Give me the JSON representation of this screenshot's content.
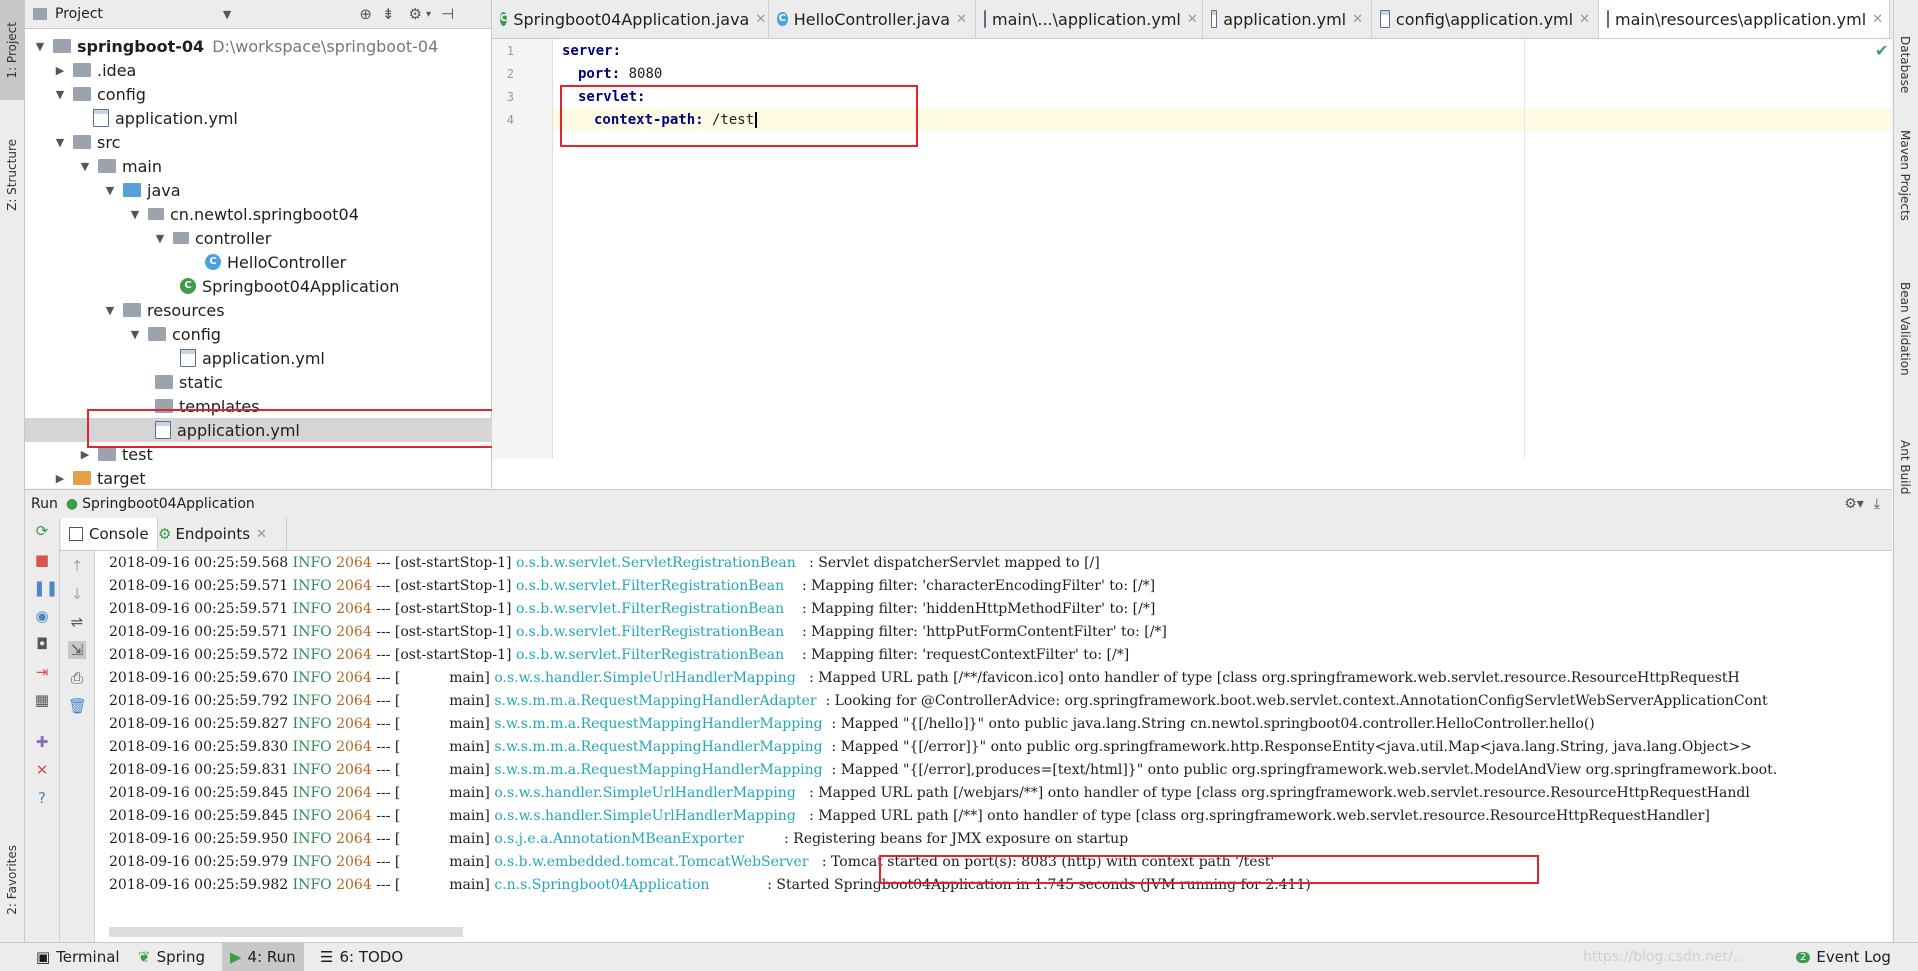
{
  "left_stripe": {
    "project": "1: Project",
    "structure": "Z: Structure",
    "favorites": "2: Favorites"
  },
  "right_stripe": {
    "database": "Database",
    "maven": "Maven Projects",
    "bean": "Bean Validation",
    "ant": "Ant Build"
  },
  "project_panel": {
    "title": "Project",
    "root_name": "springboot-04",
    "root_path": "D:\\workspace\\springboot-04",
    "items": [
      {
        "label": "springboot-04"
      },
      {
        "label": ".idea"
      },
      {
        "label": "config"
      },
      {
        "label": "application.yml"
      },
      {
        "label": "src"
      },
      {
        "label": "main"
      },
      {
        "label": "java"
      },
      {
        "label": "cn.newtol.springboot04"
      },
      {
        "label": "controller"
      },
      {
        "label": "HelloController"
      },
      {
        "label": "Springboot04Application"
      },
      {
        "label": "resources"
      },
      {
        "label": "config"
      },
      {
        "label": "application.yml"
      },
      {
        "label": "static"
      },
      {
        "label": "templates"
      },
      {
        "label": "application.yml"
      },
      {
        "label": "test"
      },
      {
        "label": "target"
      }
    ]
  },
  "editor_tabs": [
    {
      "label": "Springboot04Application.java"
    },
    {
      "label": "HelloController.java"
    },
    {
      "label": "main\\...\\application.yml"
    },
    {
      "label": "application.yml"
    },
    {
      "label": "config\\application.yml"
    },
    {
      "label": "main\\resources\\application.yml"
    }
  ],
  "editor": {
    "line_numbers": [
      "1",
      "2",
      "3",
      "4"
    ],
    "lines": [
      {
        "key": "server:",
        "val": ""
      },
      {
        "key": "port:",
        "val": " 8080"
      },
      {
        "key": "servlet:",
        "val": ""
      },
      {
        "key": "context-path:",
        "val": " /test"
      }
    ]
  },
  "run": {
    "label": "Run",
    "config": "Springboot04Application",
    "tabs": [
      {
        "label": "Console"
      },
      {
        "label": "Endpoints"
      }
    ]
  },
  "console": {
    "lines": [
      {
        "ts": "2018-09-16 00:25:59.568",
        "level": "INFO",
        "pid": "2064",
        "sep": "---",
        "thread": "[ost-startStop-1]",
        "logger": "o.s.b.w.servlet.ServletRegistrationBean  ",
        "msg": " : Servlet dispatcherServlet mapped to [/]"
      },
      {
        "ts": "2018-09-16 00:25:59.571",
        "level": "INFO",
        "pid": "2064",
        "sep": "---",
        "thread": "[ost-startStop-1]",
        "logger": "o.s.b.w.servlet.FilterRegistrationBean   ",
        "msg": " : Mapping filter: 'characterEncodingFilter' to: [/*]"
      },
      {
        "ts": "2018-09-16 00:25:59.571",
        "level": "INFO",
        "pid": "2064",
        "sep": "---",
        "thread": "[ost-startStop-1]",
        "logger": "o.s.b.w.servlet.FilterRegistrationBean   ",
        "msg": " : Mapping filter: 'hiddenHttpMethodFilter' to: [/*]"
      },
      {
        "ts": "2018-09-16 00:25:59.571",
        "level": "INFO",
        "pid": "2064",
        "sep": "---",
        "thread": "[ost-startStop-1]",
        "logger": "o.s.b.w.servlet.FilterRegistrationBean   ",
        "msg": " : Mapping filter: 'httpPutFormContentFilter' to: [/*]"
      },
      {
        "ts": "2018-09-16 00:25:59.572",
        "level": "INFO",
        "pid": "2064",
        "sep": "---",
        "thread": "[ost-startStop-1]",
        "logger": "o.s.b.w.servlet.FilterRegistrationBean   ",
        "msg": " : Mapping filter: 'requestContextFilter' to: [/*]"
      },
      {
        "ts": "2018-09-16 00:25:59.670",
        "level": "INFO",
        "pid": "2064",
        "sep": "---",
        "thread": "[           main]",
        "logger": "o.s.w.s.handler.SimpleUrlHandlerMapping  ",
        "msg": " : Mapped URL path [/**/favicon.ico] onto handler of type [class org.springframework.web.servlet.resource.ResourceHttpRequestH"
      },
      {
        "ts": "2018-09-16 00:25:59.792",
        "level": "INFO",
        "pid": "2064",
        "sep": "---",
        "thread": "[           main]",
        "logger": "s.w.s.m.m.a.RequestMappingHandlerAdapter ",
        "msg": " : Looking for @ControllerAdvice: org.springframework.boot.web.servlet.context.AnnotationConfigServletWebServerApplicationCont"
      },
      {
        "ts": "2018-09-16 00:25:59.827",
        "level": "INFO",
        "pid": "2064",
        "sep": "---",
        "thread": "[           main]",
        "logger": "s.w.s.m.m.a.RequestMappingHandlerMapping ",
        "msg": " : Mapped \"{[/hello]}\" onto public java.lang.String cn.newtol.springboot04.controller.HelloController.hello()"
      },
      {
        "ts": "2018-09-16 00:25:59.830",
        "level": "INFO",
        "pid": "2064",
        "sep": "---",
        "thread": "[           main]",
        "logger": "s.w.s.m.m.a.RequestMappingHandlerMapping ",
        "msg": " : Mapped \"{[/error]}\" onto public org.springframework.http.ResponseEntity<java.util.Map<java.lang.String, java.lang.Object>>"
      },
      {
        "ts": "2018-09-16 00:25:59.831",
        "level": "INFO",
        "pid": "2064",
        "sep": "---",
        "thread": "[           main]",
        "logger": "s.w.s.m.m.a.RequestMappingHandlerMapping ",
        "msg": " : Mapped \"{[/error],produces=[text/html]}\" onto public org.springframework.web.servlet.ModelAndView org.springframework.boot."
      },
      {
        "ts": "2018-09-16 00:25:59.845",
        "level": "INFO",
        "pid": "2064",
        "sep": "---",
        "thread": "[           main]",
        "logger": "o.s.w.s.handler.SimpleUrlHandlerMapping  ",
        "msg": " : Mapped URL path [/webjars/**] onto handler of type [class org.springframework.web.servlet.resource.ResourceHttpRequestHandl"
      },
      {
        "ts": "2018-09-16 00:25:59.845",
        "level": "INFO",
        "pid": "2064",
        "sep": "---",
        "thread": "[           main]",
        "logger": "o.s.w.s.handler.SimpleUrlHandlerMapping  ",
        "msg": " : Mapped URL path [/**] onto handler of type [class org.springframework.web.servlet.resource.ResourceHttpRequestHandler]"
      },
      {
        "ts": "2018-09-16 00:25:59.950",
        "level": "INFO",
        "pid": "2064",
        "sep": "---",
        "thread": "[           main]",
        "logger": "o.s.j.e.a.AnnotationMBeanExporter        ",
        "msg": " : Registering beans for JMX exposure on startup"
      },
      {
        "ts": "2018-09-16 00:25:59.979",
        "level": "INFO",
        "pid": "2064",
        "sep": "---",
        "thread": "[           main]",
        "logger": "o.s.b.w.embedded.tomcat.TomcatWebServer  ",
        "msg": " : Tomcat started on port(s): 8083 (http) with context path '/test'"
      },
      {
        "ts": "2018-09-16 00:25:59.982",
        "level": "INFO",
        "pid": "2064",
        "sep": "---",
        "thread": "[           main]",
        "logger": "c.n.s.Springboot04Application            ",
        "msg": " : Started Springboot04Application in 1.745 seconds (JVM running for 2.411)"
      }
    ]
  },
  "bottom_bar": {
    "terminal": "Terminal",
    "spring": "Spring",
    "run": "4: Run",
    "todo": "6: TODO",
    "watermark": "https://blog.csdn.net/...",
    "event_log": "Event Log",
    "event_count": "2"
  }
}
